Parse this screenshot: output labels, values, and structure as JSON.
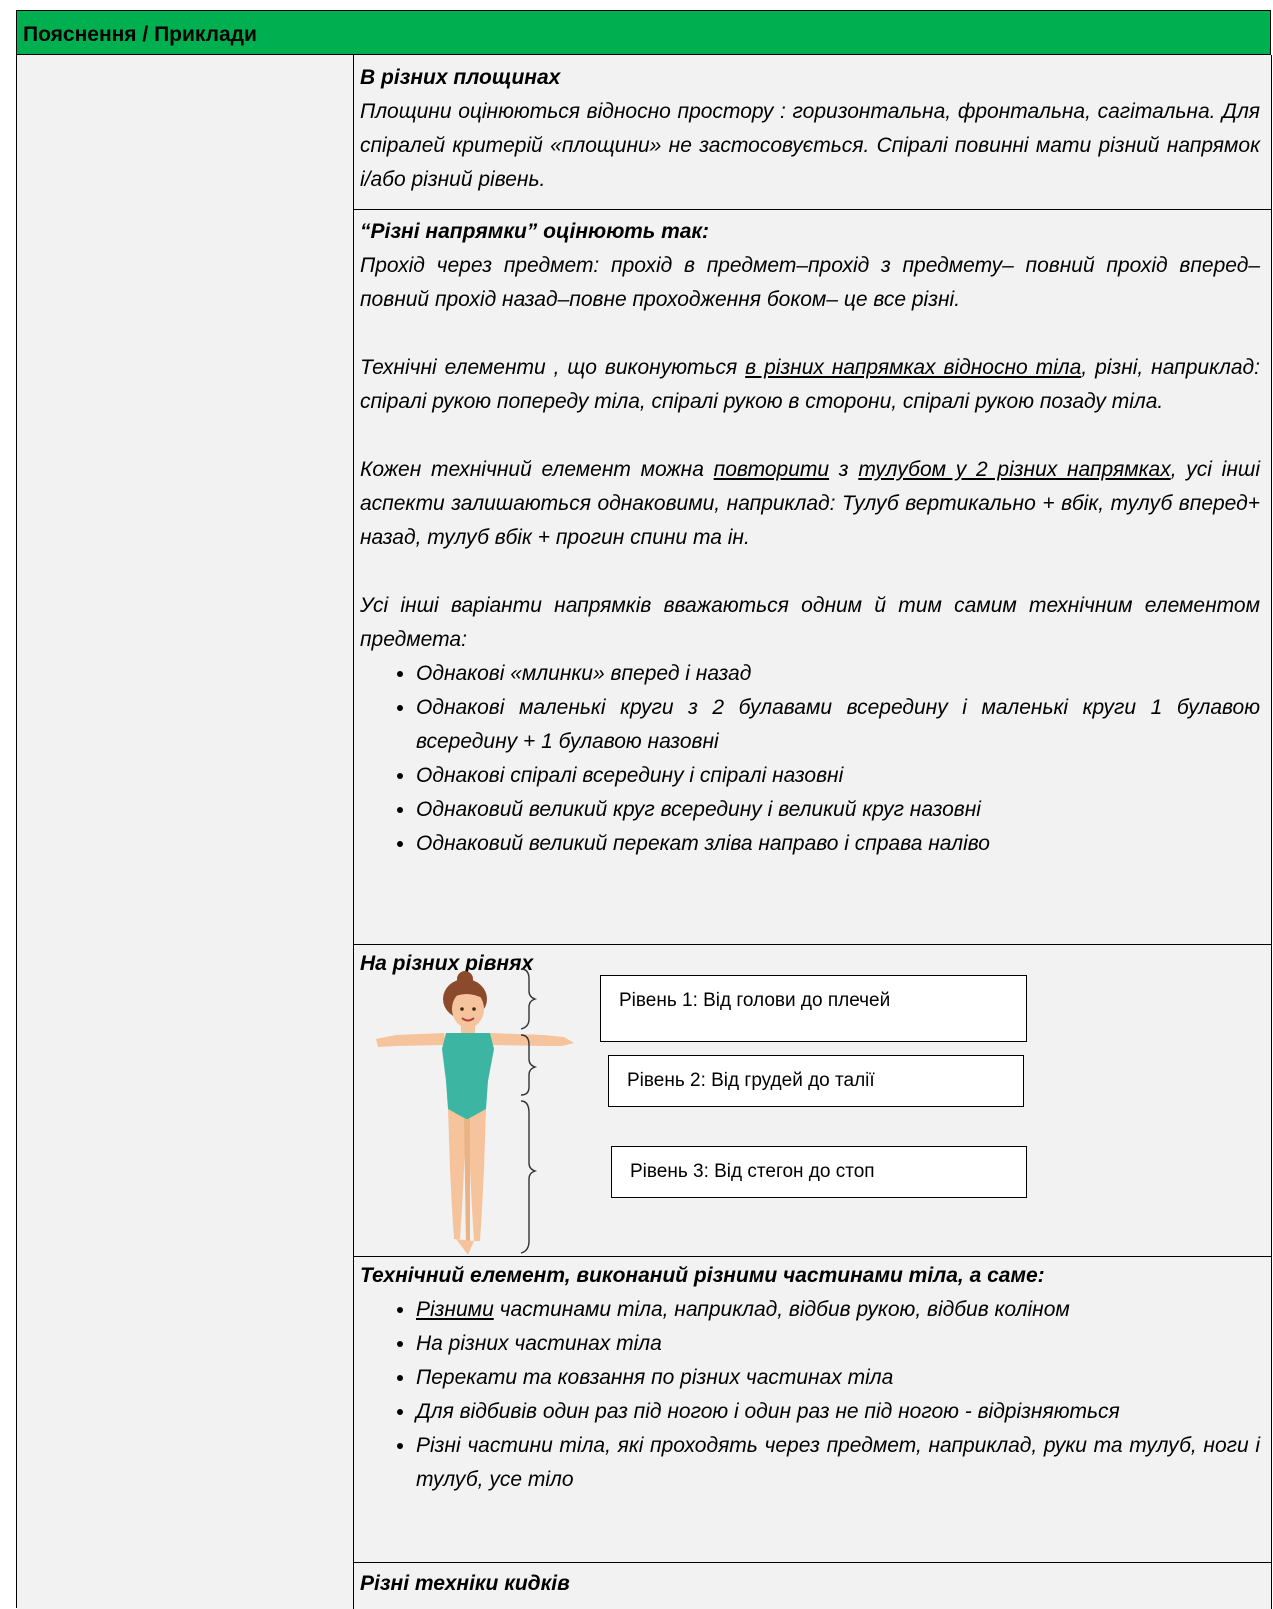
{
  "header": {
    "title": "Пояснення  / Приклади"
  },
  "planes": {
    "heading": "В різних площинах",
    "text": "Площини оцінюються відносно простору : горизонтальна, фронтальна, сагітальна. Для спіралей критерій «площини» не застосовується. Спіралі повинні мати різний напрямок і/або різний рівень."
  },
  "directions": {
    "heading": "“Різні напрямки” оцінюють так:",
    "p1": "Прохід через предмет: прохід в предмет–прохід з предмету– повний прохід вперед–повний прохід назад–повне проходження боком– це все різні.",
    "p2_a": "Технічні елементи , що виконуються ",
    "p2_u": "в різних напрямках відносно тіла",
    "p2_b": ", різні, наприклад: спіралі  рукою попереду тіла, спіралі  рукою в сторони, спіралі  рукою позаду тіла.",
    "p3_a": "Кожен технічний елемент можна ",
    "p3_u1": "повторити",
    "p3_b": " з ",
    "p3_u2": "тулубом у 2 різних напрямках",
    "p3_c": ", усі інші аспекти залишаються однаковими, наприклад: Тулуб вертикально + вбік, тулуб вперед+ назад, тулуб вбік + прогин спини та ін.",
    "p4": "Усі інші варіанти напрямків вважаються одним й тим самим технічним елементом предмета:",
    "items": [
      "Однакові «млинки» вперед і назад",
      "Однакові маленькі круги з 2 булавами всередину і маленькі круги 1 булавою всередину  + 1 булавою назовні",
      "Однакові спіралі всередину і спіралі назовні",
      "Однаковий великий круг всередину і великий круг назовні",
      "Однаковий великий перекат зліва направо і справа наліво"
    ]
  },
  "levels": {
    "heading": "На різних рівнях",
    "level1": "Рівень 1: Від голови до плечей",
    "level2": "Рівень 2: Від грудей до талії",
    "level3": "Рівень 3: Від стегон до стоп"
  },
  "bodyparts": {
    "heading": "Технічний елемент, виконаний різними частинами тіла, а саме:",
    "item1_u": "Різними",
    "item1_rest": " частинами тіла, наприклад, відбив рукою, відбив коліном",
    "items": [
      "На різних частинах тіла",
      "Перекати та ковзання по різних частинах тіла",
      "Для відбивів один раз під ногою і один раз не під ногою - відрізняються",
      "Різні частини тіла, які проходять через предмет, наприклад, руки та тулуб, ноги і тулуб, усе тіло"
    ]
  },
  "throws": {
    "heading": "Різні техніки кидків"
  },
  "colors": {
    "header_bg": "#00b050",
    "skin": "#f6c49c",
    "leotard": "#3cb6a3",
    "hair": "#8b4a2b"
  }
}
